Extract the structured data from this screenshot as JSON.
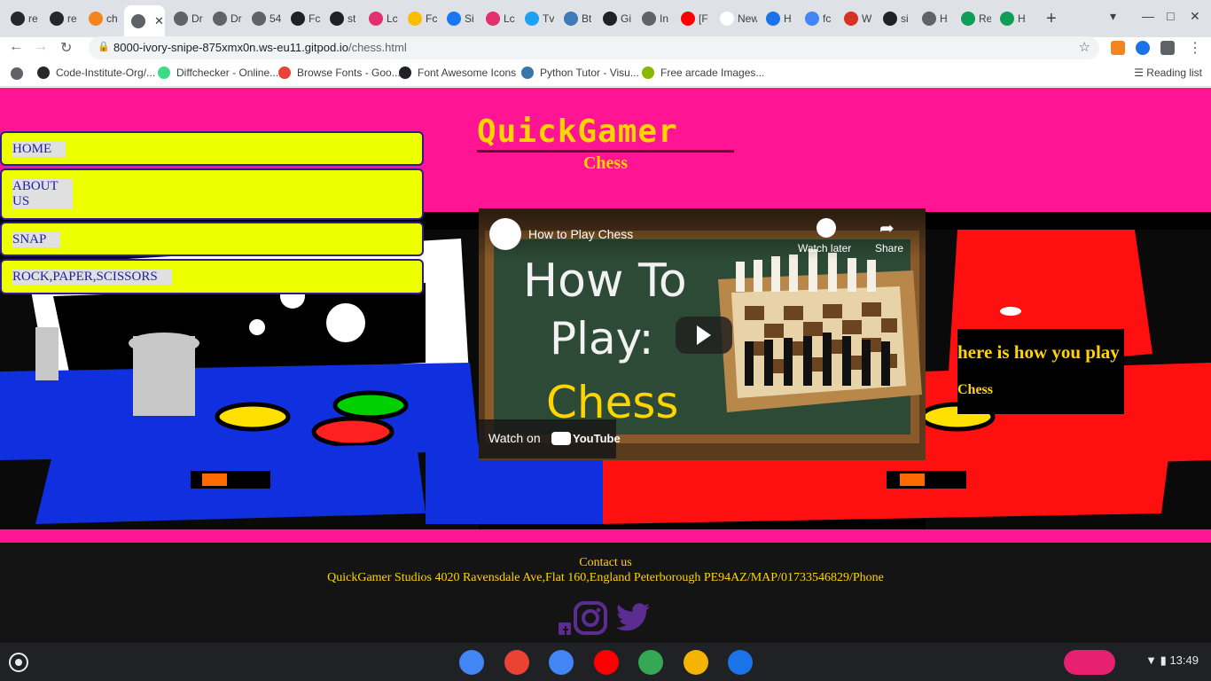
{
  "browser": {
    "tabs": [
      {
        "label": "re",
        "fav": "#24292e"
      },
      {
        "label": "re",
        "fav": "#24292e"
      },
      {
        "label": "ch",
        "fav": "#f4841f"
      },
      {
        "label": "",
        "fav": "#5f6368",
        "active": true
      },
      {
        "label": "Dr",
        "fav": "#5f6368"
      },
      {
        "label": "Dr",
        "fav": "#5f6368"
      },
      {
        "label": "54",
        "fav": "#5f6368"
      },
      {
        "label": "Fc",
        "fav": "#202124"
      },
      {
        "label": "st",
        "fav": "#202124"
      },
      {
        "label": "Lc",
        "fav": "#e1306c"
      },
      {
        "label": "Fc",
        "fav": "#fbbc04"
      },
      {
        "label": "Si",
        "fav": "#1877f2"
      },
      {
        "label": "Lc",
        "fav": "#e1306c"
      },
      {
        "label": "Tv",
        "fav": "#1da1f2"
      },
      {
        "label": "Bt",
        "fav": "#3c7ab8"
      },
      {
        "label": "Gi",
        "fav": "#202124"
      },
      {
        "label": "In",
        "fav": "#5f6368"
      },
      {
        "label": "[F",
        "fav": "#ff0000"
      },
      {
        "label": "New T",
        "fav": "#ffffff"
      },
      {
        "label": "H",
        "fav": "#1a73e8"
      },
      {
        "label": "fc",
        "fav": "#4285f4"
      },
      {
        "label": "W",
        "fav": "#d93025"
      },
      {
        "label": "si",
        "fav": "#202124"
      },
      {
        "label": "H",
        "fav": "#5f6368"
      },
      {
        "label": "Re",
        "fav": "#0f9d58"
      },
      {
        "label": "H",
        "fav": "#0f9d58"
      }
    ],
    "url_host": "8000-ivory-snipe-875xmx0n.ws-eu11.gitpod.io",
    "url_path": "/chess.html",
    "bookmarks": [
      {
        "label": "Code-Institute-Org/...",
        "icon": "#24292e"
      },
      {
        "label": "Diffchecker - Online...",
        "icon": "#3ddc84"
      },
      {
        "label": "Browse Fonts - Goo...",
        "icon": "#ea4335"
      },
      {
        "label": "Font Awesome Icons",
        "icon": "#202124"
      },
      {
        "label": "Python Tutor - Visu...",
        "icon": "#3776ab"
      },
      {
        "label": "Free arcade Images...",
        "icon": "#8ab800"
      }
    ],
    "reading_list": "Reading list"
  },
  "nav": {
    "home": "HOME",
    "about": "ABOUT\nUS",
    "snap": "SNAP",
    "rps": "ROCK,PAPER,SCISSORS"
  },
  "header": {
    "logo": "QuickGamer",
    "subtitle": "Chess"
  },
  "video": {
    "title": "How to Play Chess",
    "watch_later": "Watch later",
    "share": "Share",
    "thumb_line1": "How To",
    "thumb_line2": "Play:",
    "thumb_line3": "Chess",
    "watch_on": "Watch on",
    "youtube": "YouTube"
  },
  "info": {
    "title": "here is how you play",
    "sub": "Chess"
  },
  "footer": {
    "contact_title": "Contact us",
    "contact_address": "QuickGamer Studios 4020 Ravensdale Ave,Flat 160,England Peterborough PE94AZ/MAP/01733546829/Phone"
  },
  "shelf": {
    "time": "13:49",
    "apps": [
      {
        "name": "chrome",
        "color": "#4285f4"
      },
      {
        "name": "gmail",
        "color": "#ea4335"
      },
      {
        "name": "docs",
        "color": "#4285f4"
      },
      {
        "name": "youtube",
        "color": "#ff0000"
      },
      {
        "name": "play-store",
        "color": "#34a853"
      },
      {
        "name": "slides",
        "color": "#f4b400"
      },
      {
        "name": "files",
        "color": "#1a73e8"
      }
    ]
  },
  "colors": {
    "page_bg": "#ff1493",
    "nav_bg": "#eeff00",
    "accent_yellow": "#ffd400",
    "footer_bg": "#141414"
  }
}
